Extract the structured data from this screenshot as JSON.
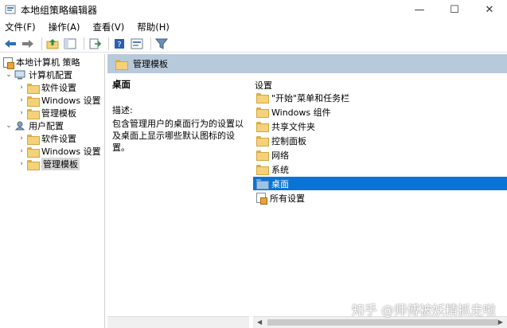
{
  "window": {
    "title": "本地组策略编辑器",
    "controls": {
      "minimize": "—",
      "maximize": "☐",
      "close": "✕"
    }
  },
  "menu": [
    "文件(F)",
    "操作(A)",
    "查看(V)",
    "帮助(H)"
  ],
  "toolbar": {
    "icons": [
      "back-arrow-icon",
      "forward-arrow-icon",
      "up-folder-icon",
      "show-tree-icon",
      "export-list-icon",
      "help-icon",
      "properties-icon",
      "filter-icon"
    ]
  },
  "tree": {
    "root": "本地计算机 策略",
    "computer": "计算机配置",
    "computer_children": [
      "软件设置",
      "Windows 设置",
      "管理模板"
    ],
    "user": "用户配置",
    "user_children": [
      "软件设置",
      "Windows 设置",
      "管理模板"
    ],
    "selected": "管理模板"
  },
  "header": {
    "title": "管理模板"
  },
  "description": {
    "title": "桌面",
    "label": "描述:",
    "text": "包含管理用户的桌面行为的设置以及桌面上显示哪些默认图标的设置。"
  },
  "list": {
    "column_header": "设置",
    "items": [
      "\"开始\"菜单和任务栏",
      "Windows 组件",
      "共享文件夹",
      "控制面板",
      "网络",
      "系统",
      "桌面",
      "所有设置"
    ],
    "selected": "桌面"
  },
  "watermark": "知乎 @师傅被妖精抓走啦",
  "colors": {
    "selection": "#0a74d6",
    "header_bar": "#b9c9dc",
    "folder": "#f4d27a"
  }
}
